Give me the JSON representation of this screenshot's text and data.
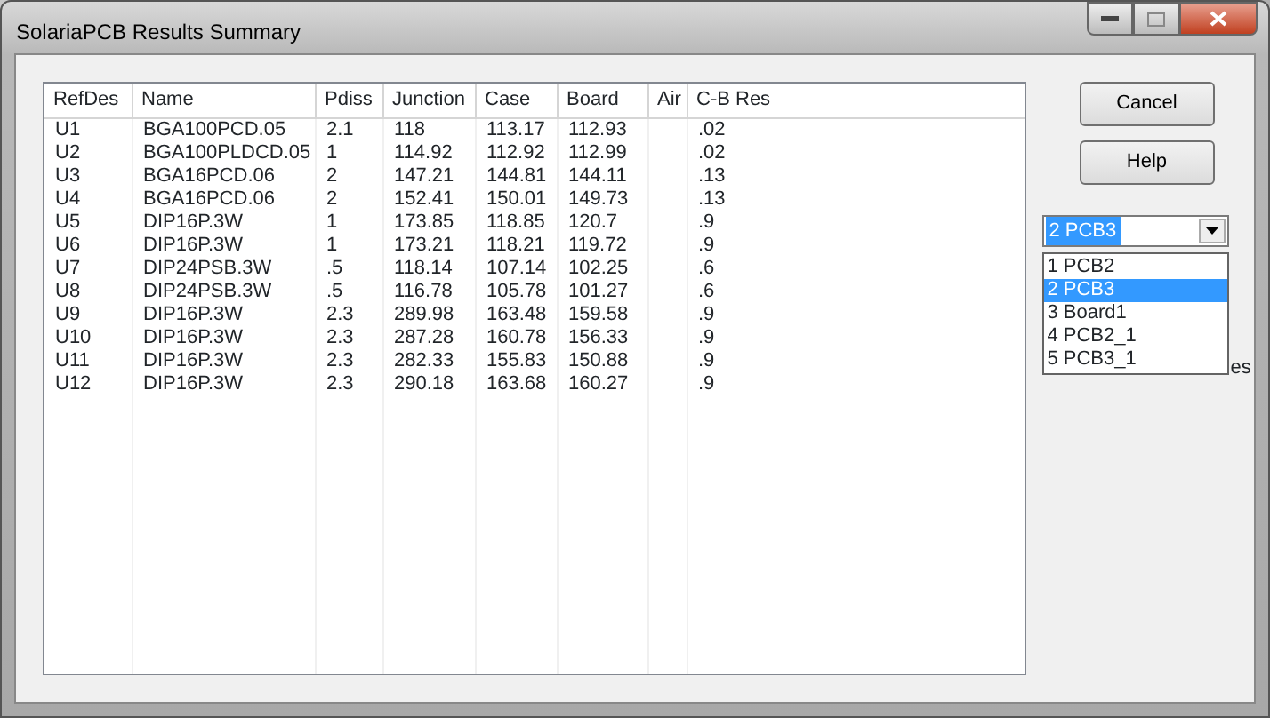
{
  "window": {
    "title": "SolariaPCB Results Summary"
  },
  "table": {
    "columns": [
      "RefDes",
      "Name",
      "Pdiss",
      "Junction",
      "Case",
      "Board",
      "Air",
      "C-B Res"
    ],
    "rows": [
      [
        "U1",
        "BGA100PCD.05",
        "2.1",
        "118",
        "113.17",
        "112.93",
        "",
        ".02"
      ],
      [
        "U2",
        "BGA100PLDCD.05",
        "1",
        "114.92",
        "112.92",
        "112.99",
        "",
        ".02"
      ],
      [
        "U3",
        "BGA16PCD.06",
        "2",
        "147.21",
        "144.81",
        "144.11",
        "",
        ".13"
      ],
      [
        "U4",
        "BGA16PCD.06",
        "2",
        "152.41",
        "150.01",
        "149.73",
        "",
        ".13"
      ],
      [
        "U5",
        "DIP16P.3W",
        "1",
        "173.85",
        "118.85",
        "120.7",
        "",
        ".9"
      ],
      [
        "U6",
        "DIP16P.3W",
        "1",
        "173.21",
        "118.21",
        "119.72",
        "",
        ".9"
      ],
      [
        "U7",
        "DIP24PSB.3W",
        ".5",
        "118.14",
        "107.14",
        "102.25",
        "",
        ".6"
      ],
      [
        "U8",
        "DIP24PSB.3W",
        ".5",
        "116.78",
        "105.78",
        "101.27",
        "",
        ".6"
      ],
      [
        "U9",
        "DIP16P.3W",
        "2.3",
        "289.98",
        "163.48",
        "159.58",
        "",
        ".9"
      ],
      [
        "U10",
        "DIP16P.3W",
        "2.3",
        "287.28",
        "160.78",
        "156.33",
        "",
        ".9"
      ],
      [
        "U11",
        "DIP16P.3W",
        "2.3",
        "282.33",
        "155.83",
        "150.88",
        "",
        ".9"
      ],
      [
        "U12",
        "DIP16P.3W",
        "2.3",
        "290.18",
        "163.68",
        "160.27",
        "",
        ".9"
      ]
    ]
  },
  "buttons": [
    "Cancel",
    "Help"
  ],
  "board_select": {
    "value": "2 PCB3",
    "options": [
      {
        "label": "1 PCB2",
        "selected": false
      },
      {
        "label": "2 PCB3",
        "selected": true
      },
      {
        "label": "3 Board1",
        "selected": false
      },
      {
        "label": "4 PCB2_1",
        "selected": false
      },
      {
        "label": "5 PCB3_1",
        "selected": false
      }
    ]
  },
  "hidden_label": "es"
}
